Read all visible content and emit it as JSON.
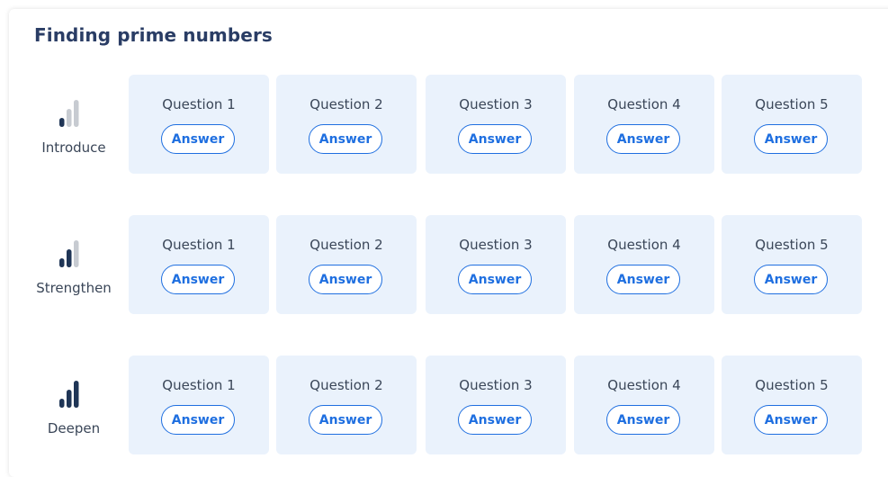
{
  "lesson": {
    "title": "Finding prime numbers"
  },
  "colors": {
    "title": "#2a3d65",
    "cell_background": "#eaf2fc",
    "answer_accent": "#1f6fe0",
    "bar_active": "#1f3556",
    "bar_inactive": "#c7cbd1"
  },
  "levels": [
    {
      "name": "Introduce",
      "icon": "signal-strength-1-icon",
      "bars_active": 1,
      "questions": [
        {
          "label": "Question 1",
          "action": "Answer"
        },
        {
          "label": "Question 2",
          "action": "Answer"
        },
        {
          "label": "Question 3",
          "action": "Answer"
        },
        {
          "label": "Question 4",
          "action": "Answer"
        },
        {
          "label": "Question 5",
          "action": "Answer"
        }
      ]
    },
    {
      "name": "Strengthen",
      "icon": "signal-strength-2-icon",
      "bars_active": 2,
      "questions": [
        {
          "label": "Question 1",
          "action": "Answer"
        },
        {
          "label": "Question 2",
          "action": "Answer"
        },
        {
          "label": "Question 3",
          "action": "Answer"
        },
        {
          "label": "Question 4",
          "action": "Answer"
        },
        {
          "label": "Question 5",
          "action": "Answer"
        }
      ]
    },
    {
      "name": "Deepen",
      "icon": "signal-strength-3-icon",
      "bars_active": 3,
      "questions": [
        {
          "label": "Question 1",
          "action": "Answer"
        },
        {
          "label": "Question 2",
          "action": "Answer"
        },
        {
          "label": "Question 3",
          "action": "Answer"
        },
        {
          "label": "Question 4",
          "action": "Answer"
        },
        {
          "label": "Question 5",
          "action": "Answer"
        }
      ]
    }
  ]
}
